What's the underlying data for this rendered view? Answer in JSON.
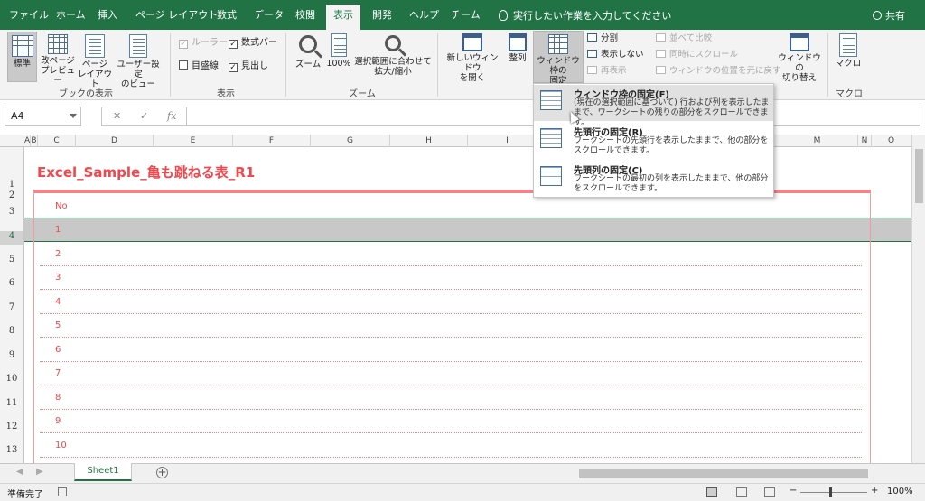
{
  "ribbon_tabs": [
    "ファイル",
    "ホーム",
    "挿入",
    "ページ レイアウト",
    "数式",
    "データ",
    "校閲",
    "表示",
    "開発",
    "ヘルプ",
    "チーム"
  ],
  "active_tab": "表示",
  "tell_me": "実行したい作業を入力してください",
  "share": "共有",
  "groups": {
    "book_view": {
      "label": "ブックの表示",
      "normal": "標準",
      "page_break": [
        "改ページ",
        "プレビュー"
      ],
      "page_layout": [
        "ページ",
        "レイアウト"
      ],
      "custom_view": [
        "ユーザー設定",
        "のビュー"
      ]
    },
    "show": {
      "label": "表示",
      "ruler": "ルーラー",
      "formula_bar": "数式バー",
      "gridlines": "目盛線",
      "headings": "見出し"
    },
    "zoom": {
      "label": "ズーム",
      "zoom": "ズーム",
      "hundred": "100%",
      "zoom_selection": [
        "選択範囲に合わせて",
        "拡大/縮小"
      ]
    },
    "window": {
      "new_window": [
        "新しいウィンドウ",
        "を開く"
      ],
      "arrange": "整列",
      "freeze": [
        "ウィンドウ枠の",
        "固定"
      ],
      "split": "分割",
      "hide": "表示しない",
      "unhide": "再表示",
      "side_by_side": "並べて比較",
      "sync_scroll": "同時にスクロール",
      "reset_position": "ウィンドウの位置を元に戻す",
      "switch": [
        "ウィンドウの",
        "切り替え"
      ]
    },
    "macro": {
      "label": "マクロ",
      "macro": "マクロ"
    }
  },
  "name_box": "A4",
  "fx": "fx",
  "columns": [
    "A",
    "B",
    "C",
    "D",
    "E",
    "F",
    "G",
    "H",
    "I",
    "M",
    "N",
    "O"
  ],
  "rows": [
    "1",
    "2",
    "3",
    "4",
    "5",
    "6",
    "7",
    "8",
    "9",
    "10",
    "11",
    "12",
    "13"
  ],
  "sheet_title": "Excel_Sample_亀も跳ねる表_R1",
  "table": {
    "header": "No",
    "rows": [
      "1",
      "2",
      "3",
      "4",
      "5",
      "6",
      "7",
      "8",
      "9",
      "10"
    ]
  },
  "freeze_menu": [
    {
      "title": "ウィンドウ枠の固定(F)",
      "desc": "(現在の選択範囲に基づいて) 行および列を表示したままで、ワークシートの残りの部分をスクロールできます。"
    },
    {
      "title": "先頭行の固定(R)",
      "desc": "ワークシートの先頭行を表示したままで、他の部分をスクロールできます。"
    },
    {
      "title": "先頭列の固定(C)",
      "desc": "ワークシートの最初の列を表示したままで、他の部分をスクロールできます。"
    }
  ],
  "sheet_tab": "Sheet1",
  "status": "準備完了",
  "zoom_level": "100%",
  "colors": {
    "excel_green": "#217346",
    "accent_red": "#f0484e"
  }
}
